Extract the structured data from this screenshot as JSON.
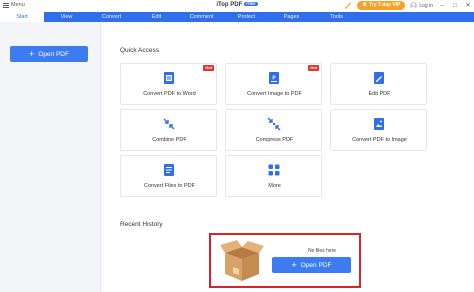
{
  "titlebar": {
    "menu_label": "Menu",
    "app_title": "iTop PDF",
    "free_badge": "FREE",
    "vip_label": "Try 7-day VIP",
    "login_label": "Log in"
  },
  "tabs": [
    {
      "label": "Start",
      "active": true
    },
    {
      "label": "View"
    },
    {
      "label": "Convert"
    },
    {
      "label": "Edit"
    },
    {
      "label": "Comment"
    },
    {
      "label": "Protect"
    },
    {
      "label": "Pages"
    },
    {
      "label": "Tools"
    }
  ],
  "sidebar": {
    "open_pdf_label": "Open PDF"
  },
  "quick_access": {
    "title": "Quick Access",
    "hot_label": "Hot",
    "items": [
      {
        "label": "Convert PDF to Word",
        "icon": "pdf-to-word-icon",
        "hot": true
      },
      {
        "label": "Convert Image to PDF",
        "icon": "image-to-pdf-icon",
        "hot": true
      },
      {
        "label": "Edit PDF",
        "icon": "edit-pdf-icon"
      },
      {
        "label": "Combine PDF",
        "icon": "combine-pdf-icon"
      },
      {
        "label": "Compress PDF",
        "icon": "compress-pdf-icon"
      },
      {
        "label": "Convert PDF to Image",
        "icon": "pdf-to-image-icon"
      },
      {
        "label": "Convert Files to PDF",
        "icon": "files-to-pdf-icon"
      },
      {
        "label": "More",
        "icon": "more-icon"
      }
    ]
  },
  "recent_history": {
    "title": "Recent History",
    "empty_text": "No files here",
    "open_pdf_label": "Open PDF"
  },
  "colors": {
    "accent": "#2f6fec",
    "vip": "#f6a226",
    "hot": "#e8322f",
    "highlight_border": "#d4262a"
  }
}
